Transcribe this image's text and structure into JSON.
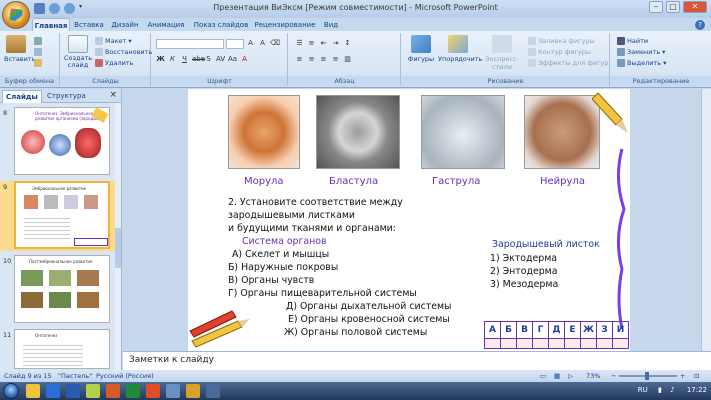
{
  "window": {
    "title": "Презентация ВиЭксм [Режим совместимости] - Microsoft PowerPoint"
  },
  "tabs": [
    "Главная",
    "Вставка",
    "Дизайн",
    "Анимация",
    "Показ слайдов",
    "Рецензирование",
    "Вид"
  ],
  "ribbon": {
    "clipboard": {
      "paste": "Вставить",
      "label": "Буфер обмена"
    },
    "slides": {
      "create": "Создать слайд",
      "layout": "Макет",
      "reset": "Восстановить",
      "delete": "Удалить",
      "label": "Слайды"
    },
    "font": {
      "label": "Шрифт"
    },
    "paragraph": {
      "label": "Абзац"
    },
    "drawing": {
      "shapes": "Фигуры",
      "arrange": "Упорядочить",
      "quick_styles": "Экспресс-стили",
      "fill": "Заливка фигуры",
      "outline": "Контур фигуры",
      "effects": "Эффекты для фигур",
      "label": "Рисование"
    },
    "editing": {
      "find": "Найти",
      "replace": "Заменить",
      "select": "Выделить",
      "label": "Редактирование"
    }
  },
  "left_pane": {
    "tab_slides": "Слайды",
    "tab_outline": "Структура",
    "thumbnails": [
      {
        "num": "8",
        "title": "Онтогенез. Эмбриональное развитие организма (зародыш)"
      },
      {
        "num": "9",
        "title": "Эмбриональное развитие"
      },
      {
        "num": "10",
        "title": "Постэмбриональное развитие"
      },
      {
        "num": "11",
        "title": "Онтогенез"
      }
    ]
  },
  "slide": {
    "stages": [
      "Морула",
      "Бластула",
      "Гаструла",
      "Нейрула"
    ],
    "task_lines": [
      "2. Установите соответствие между",
      "зародышевыми листками",
      "и будущими тканями и органами:"
    ],
    "organs_header": "Система органов",
    "organs": [
      "А) Скелет и мышцы",
      "Б) Наружные покровы",
      "В) Органы чувств",
      "Г) Органы пищеварительной системы",
      "Д) Органы дыхательной системы",
      "Е) Органы кровеносной системы",
      "Ж) Органы половой системы"
    ],
    "layer_header": "Зародышевый листок",
    "layers": [
      "1)  Эктодерма",
      "2)  Энтодерма",
      "3)  Мезодерма"
    ],
    "answer_headers": [
      "А",
      "Б",
      "В",
      "Г",
      "Д",
      "Е",
      "Ж",
      "З",
      "И"
    ]
  },
  "notes_placeholder": "Заметки к слайду",
  "status": {
    "slide_of": "Слайд 9 из 15",
    "theme": "\"Пастель\"",
    "language": "Русский (Россия)",
    "zoom": "73%"
  },
  "taskbar": {
    "lang": "RU",
    "time": "17:22"
  }
}
